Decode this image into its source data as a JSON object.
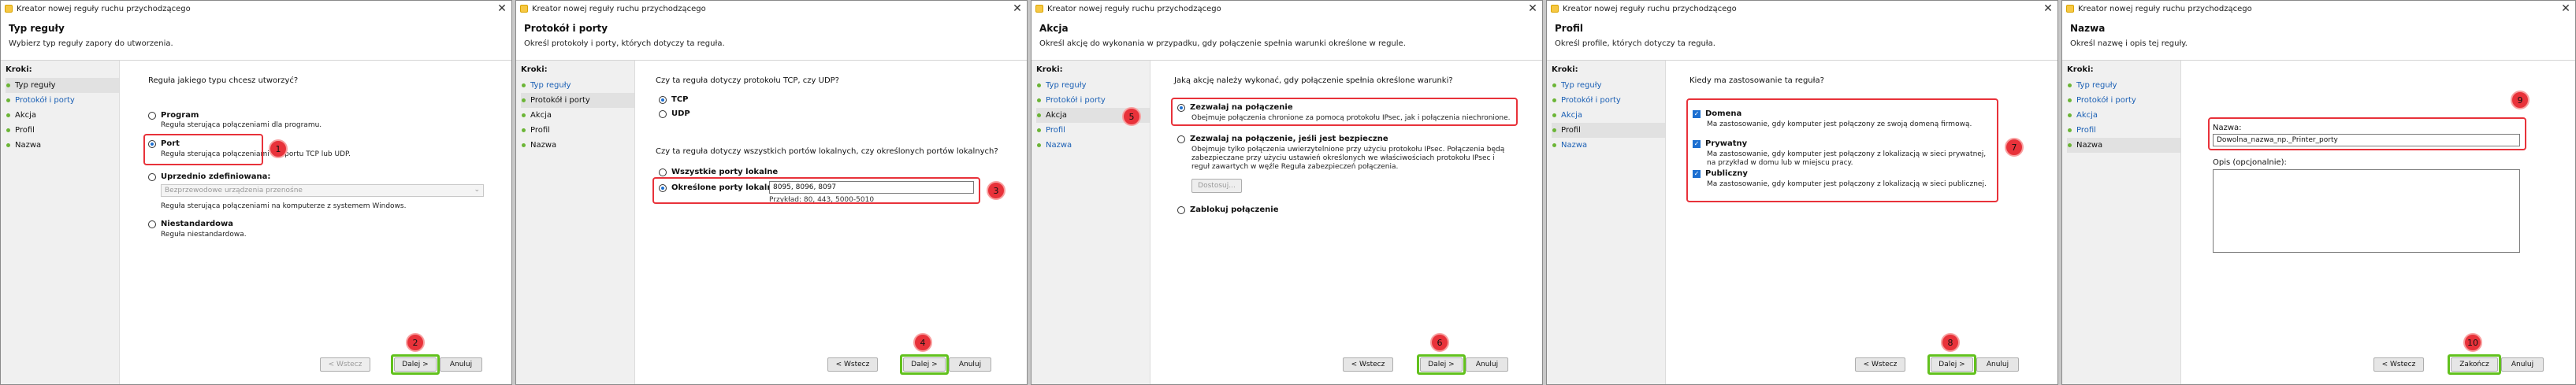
{
  "window_title": "Kreator nowej reguły ruchu przychodzącego",
  "steps_label": "Kroki:",
  "steps": [
    "Typ reguły",
    "Protokół i porty",
    "Akcja",
    "Profil",
    "Nazwa"
  ],
  "nav": {
    "back": "< Wstecz",
    "next": "Dalej >",
    "cancel": "Anuluj",
    "finish": "Zakończ"
  },
  "w1": {
    "header": "Typ reguły",
    "subheader": "Wybierz typ reguły zapory do utworzenia.",
    "question": "Reguła jakiego typu chcesz utworzyć?",
    "opt_program": "Program",
    "desc_program": "Reguła sterująca połączeniami dla programu.",
    "opt_port": "Port",
    "desc_port": "Reguła sterująca połączeniami dla portu TCP lub UDP.",
    "opt_predef": "Uprzednio zdefiniowana:",
    "predef_value": "Bezprzewodowe urządzenia przenośne",
    "desc_predef": "Reguła sterująca połączeniami na komputerze z systemem Windows.",
    "opt_custom": "Niestandardowa",
    "desc_custom": "Reguła niestandardowa."
  },
  "w2": {
    "header": "Protokół i porty",
    "subheader": "Określ protokoły i porty, których dotyczy ta reguła.",
    "q1": "Czy ta reguła dotyczy protokołu TCP, czy UDP?",
    "tcp": "TCP",
    "udp": "UDP",
    "q2": "Czy ta reguła dotyczy wszystkich portów lokalnych, czy określonych portów lokalnych?",
    "all_ports": "Wszystkie porty lokalne",
    "spec_ports": "Określone porty lokalne:",
    "ports_value": "8095, 8096, 8097",
    "ports_example": "Przykład: 80, 443, 5000-5010"
  },
  "w3": {
    "header": "Akcja",
    "subheader": "Określ akcję do wykonania w przypadku, gdy połączenie spełnia warunki określone w regule.",
    "question": "Jaką akcję należy wykonać, gdy połączenie spełnia określone warunki?",
    "allow": "Zezwalaj na połączenie",
    "desc_allow": "Obejmuje połączenia chronione za pomocą protokołu IPsec, jak i połączenia niechronione.",
    "allow_secure": "Zezwalaj na połączenie, jeśli jest bezpieczne",
    "desc_secure": "Obejmuje tylko połączenia uwierzytelnione przy użyciu protokołu IPsec. Połączenia będą zabezpieczane przy użyciu ustawień określonych we właściwościach protokołu IPsec i reguł zawartych w węźle Reguła zabezpieczeń połączenia.",
    "customize": "Dostosuj...",
    "block": "Zablokuj połączenie"
  },
  "w4": {
    "header": "Profil",
    "subheader": "Określ profile, których dotyczy ta reguła.",
    "question": "Kiedy ma zastosowanie ta reguła?",
    "domain": "Domena",
    "desc_domain": "Ma zastosowanie, gdy komputer jest połączony ze swoją domeną firmową.",
    "private": "Prywatny",
    "desc_private": "Ma zastosowanie, gdy komputer jest połączony z lokalizacją w sieci prywatnej, na przykład w domu lub w miejscu pracy.",
    "public": "Publiczny",
    "desc_public": "Ma zastosowanie, gdy komputer jest połączony z lokalizacją w sieci publicznej."
  },
  "w5": {
    "header": "Nazwa",
    "subheader": "Określ nazwę i opis tej reguły.",
    "name_label": "Nazwa:",
    "name_value": "Dowolna_nazwa_np._Printer_porty",
    "desc_label": "Opis (opcjonalnie):"
  },
  "badges": [
    "1",
    "2",
    "3",
    "4",
    "5",
    "6",
    "7",
    "8",
    "9",
    "10"
  ]
}
